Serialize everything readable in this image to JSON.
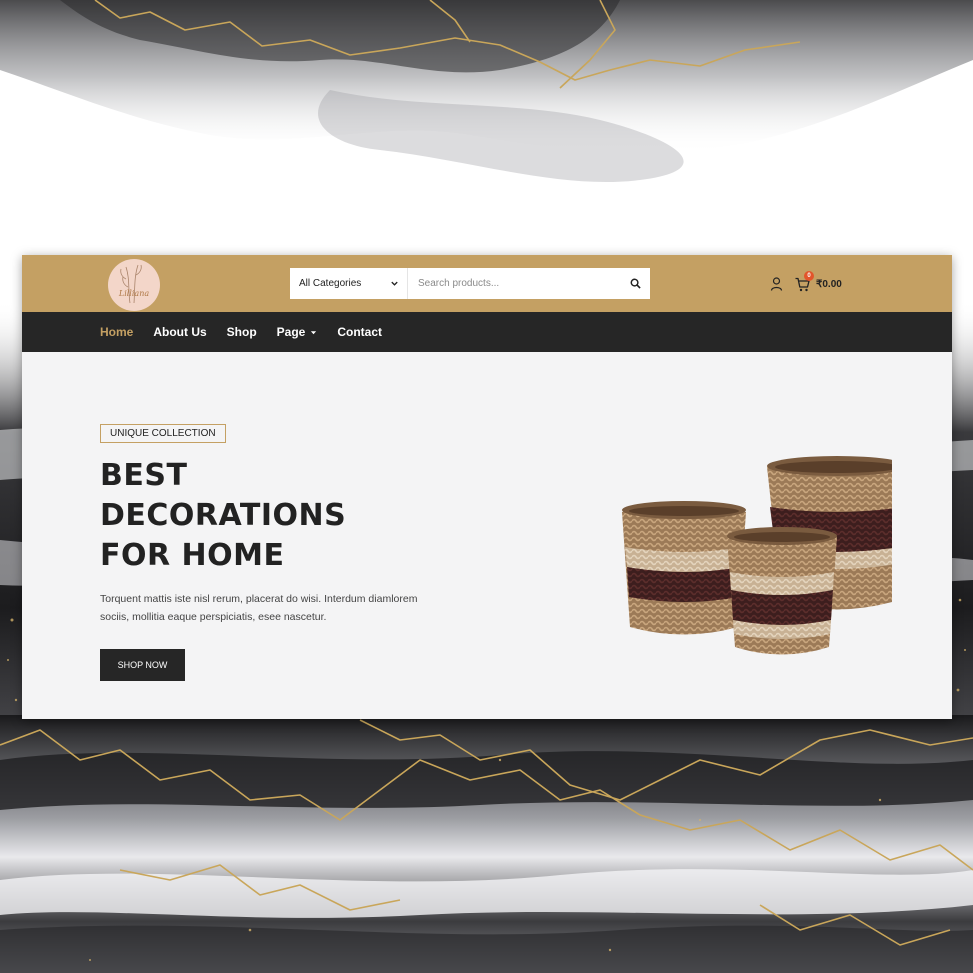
{
  "header": {
    "logo_text": "Lilliana",
    "category_select": "All Categories",
    "search_placeholder": "Search products...",
    "cart_count": "0",
    "cart_total": "₹0.00"
  },
  "nav": {
    "items": [
      {
        "label": "Home",
        "active": true
      },
      {
        "label": "About Us"
      },
      {
        "label": "Shop"
      },
      {
        "label": "Page",
        "dropdown": true
      },
      {
        "label": "Contact"
      }
    ]
  },
  "hero": {
    "tag": "UNIQUE COLLECTION",
    "headline": [
      "BEST",
      "DECORATIONS",
      "FOR HOME"
    ],
    "description": "Torquent mattis iste nisl rerum, placerat do wisi. Interdum diamlorem sociis, mollitia eaque perspiciatis, esee nascetur.",
    "button": "SHOP NOW"
  },
  "colors": {
    "accent": "#c4a063",
    "dark": "#262626",
    "badge": "#e2552b",
    "hero_bg": "#f4f4f5"
  },
  "icons": [
    "chevron-down-icon",
    "search-icon",
    "user-icon",
    "cart-icon",
    "caret-down-icon"
  ]
}
